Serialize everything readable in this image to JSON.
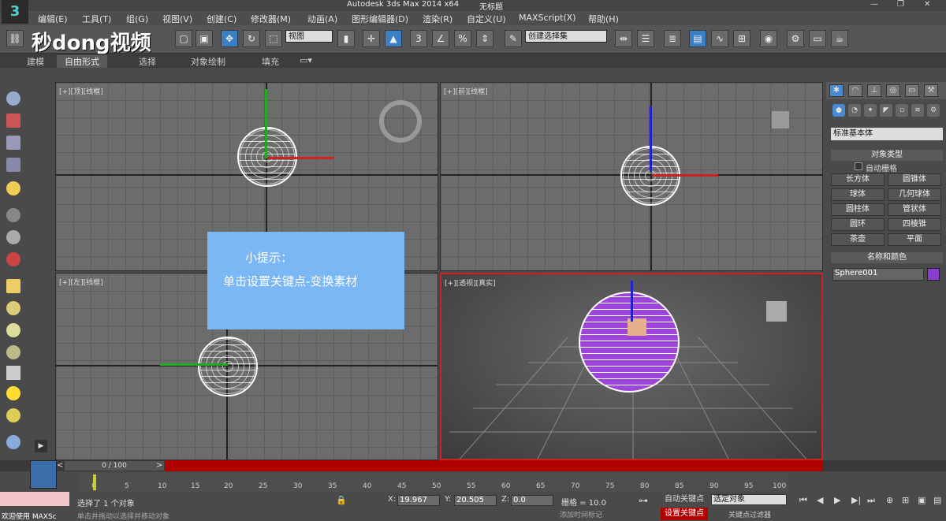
{
  "app": {
    "title": "Autodesk 3ds Max  2014 x64",
    "doc": "无标题",
    "brand": "秒dong视频"
  },
  "menu": [
    "编辑(E)",
    "工具(T)",
    "组(G)",
    "视图(V)",
    "创建(C)",
    "修改器(M)",
    "动画(A)",
    "图形编辑器(D)",
    "渲染(R)",
    "自定义(U)",
    "MAXScript(X)",
    "帮助(H)"
  ],
  "toolbar": {
    "view_select": "视图",
    "named_sel": "创建选择集"
  },
  "ribbon": [
    "建模",
    "自由形式",
    "选择",
    "对象绘制",
    "填充"
  ],
  "viewports": {
    "top": "[+][顶][线框]",
    "front": "[+][前][线框]",
    "left": "[+][左][线框]",
    "persp": "[+][透视][真实]"
  },
  "tip": {
    "title": "小提示：",
    "text": "单击设置关键点-变换素材"
  },
  "cmd": {
    "category": "标准基本体",
    "rollout1": "对象类型",
    "autogrid": "自动栅格",
    "buttons": [
      "长方体",
      "圆锥体",
      "球体",
      "几何球体",
      "圆柱体",
      "管状体",
      "圆环",
      "四棱锥",
      "茶壶",
      "平面"
    ],
    "rollout2": "名称和颜色",
    "name": "Sphere001",
    "color": "#8a3fd1"
  },
  "timeline": {
    "frame": "0 / 100",
    "ticks": [
      "0",
      "5",
      "10",
      "15",
      "20",
      "25",
      "30",
      "35",
      "40",
      "45",
      "50",
      "55",
      "60",
      "65",
      "70",
      "75",
      "80",
      "85",
      "90",
      "95",
      "100"
    ]
  },
  "status": {
    "selected": "选择了 1 个对象",
    "prompt": "单击并拖动以选择并移动对象",
    "welcome": "欢迎使用 MAXSc",
    "x": "19.967",
    "y": "20.505",
    "z": "0.0",
    "grid": "栅格 = 10.0",
    "autokey": "自动关键点",
    "setkey": "设置关键点",
    "selfilter": "选定对象",
    "keyfilter": "关键点过滤器",
    "addtime": "添加时间标记"
  }
}
